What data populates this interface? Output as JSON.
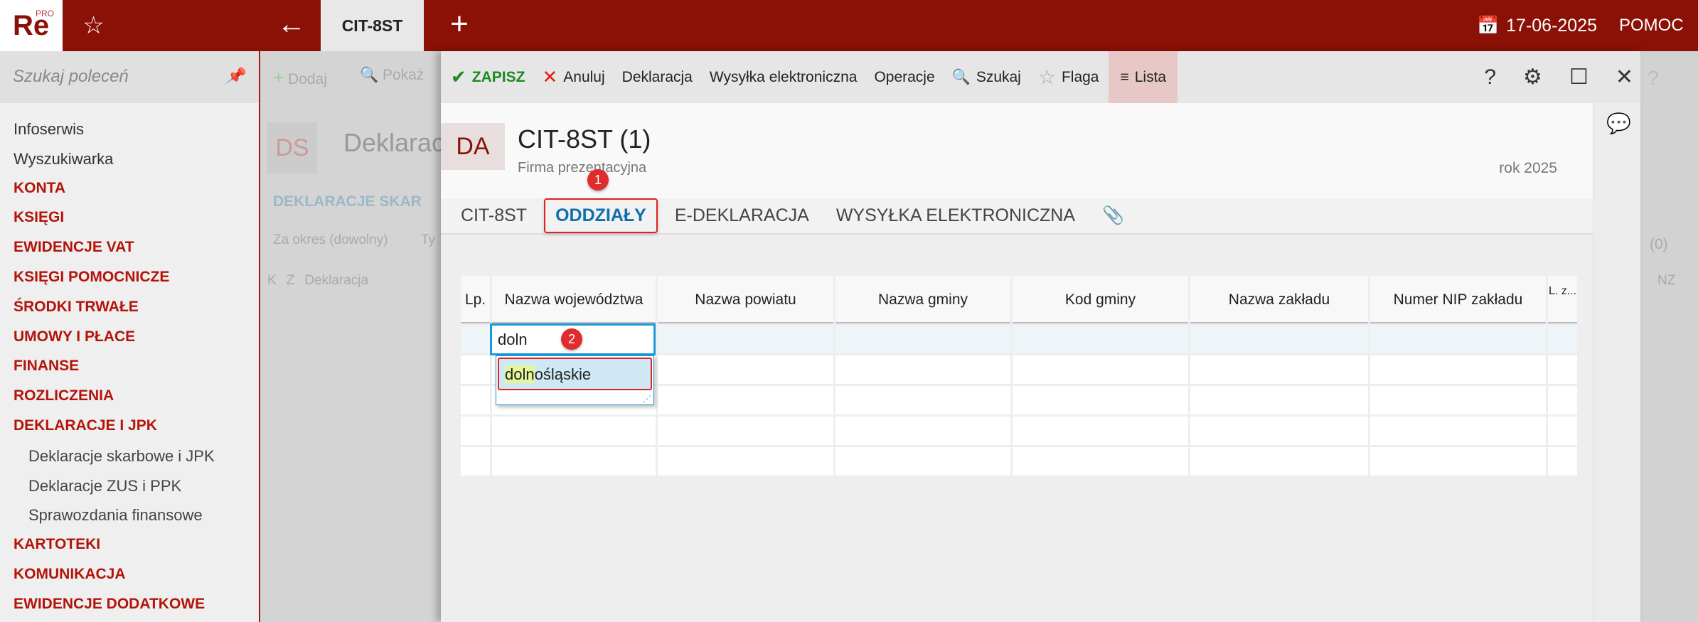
{
  "topbar": {
    "logo": "Re",
    "logo_sup": "PRO",
    "tab": "CIT-8ST",
    "date": "17-06-2025",
    "help": "POMOC"
  },
  "sidebar": {
    "search_placeholder": "Szukaj poleceń",
    "items": [
      {
        "label": "Infoserwis",
        "type": "link"
      },
      {
        "label": "Wyszukiwarka",
        "type": "link"
      },
      {
        "label": "KONTA",
        "type": "cat"
      },
      {
        "label": "KSIĘGI",
        "type": "cat"
      },
      {
        "label": "EWIDENCJE VAT",
        "type": "cat"
      },
      {
        "label": "KSIĘGI POMOCNICZE",
        "type": "cat"
      },
      {
        "label": "ŚRODKI TRWAŁE",
        "type": "cat"
      },
      {
        "label": "UMOWY I PŁACE",
        "type": "cat"
      },
      {
        "label": "FINANSE",
        "type": "cat"
      },
      {
        "label": "ROZLICZENIA",
        "type": "cat"
      },
      {
        "label": "DEKLARACJE I JPK",
        "type": "cat"
      },
      {
        "label": "Deklaracje skarbowe i JPK",
        "type": "sub"
      },
      {
        "label": "Deklaracje ZUS i PPK",
        "type": "sub"
      },
      {
        "label": "Sprawozdania finansowe",
        "type": "sub"
      },
      {
        "label": "KARTOTEKI",
        "type": "cat"
      },
      {
        "label": "KOMUNIKACJA",
        "type": "cat"
      },
      {
        "label": "EWIDENCJE DODATKOWE",
        "type": "cat"
      }
    ]
  },
  "background": {
    "add": "Dodaj",
    "show": "Pokaż",
    "badge": "DS",
    "title": "Deklarac",
    "section": "DEKLARACJE SKAR",
    "filter": "Za okres (dowolny)",
    "filter2": "Ty",
    "cols": [
      "K",
      "Z",
      "Deklaracja"
    ],
    "count": "(0)",
    "col_nz": "NZ"
  },
  "toolbar": {
    "save": "ZAPISZ",
    "cancel": "Anuluj",
    "declaration": "Deklaracja",
    "esend": "Wysyłka elektroniczna",
    "operations": "Operacje",
    "search": "Szukaj",
    "flag": "Flaga",
    "list": "Lista"
  },
  "doc": {
    "badge": "DA",
    "title": "CIT-8ST (1)",
    "company": "Firma prezentacyjna",
    "year": "rok 2025"
  },
  "tabs": [
    "CIT-8ST",
    "ODDZIAŁY",
    "E-DEKLARACJA",
    "WYSYŁKA ELEKTRONICZNA"
  ],
  "grid": {
    "columns": [
      "Lp.",
      "Nazwa województwa",
      "Nazwa powiatu",
      "Nazwa gminy",
      "Kod gminy",
      "Nazwa zakładu",
      "Numer NIP zakładu",
      "L. z..."
    ],
    "editor_value": "doln",
    "suggestion_match": "doln",
    "suggestion_rest": "ośląskie"
  },
  "annotations": [
    "1",
    "2"
  ],
  "colors": {
    "brand": "#8b1005",
    "accent": "#0d6fab",
    "highlight": "#e02020"
  }
}
